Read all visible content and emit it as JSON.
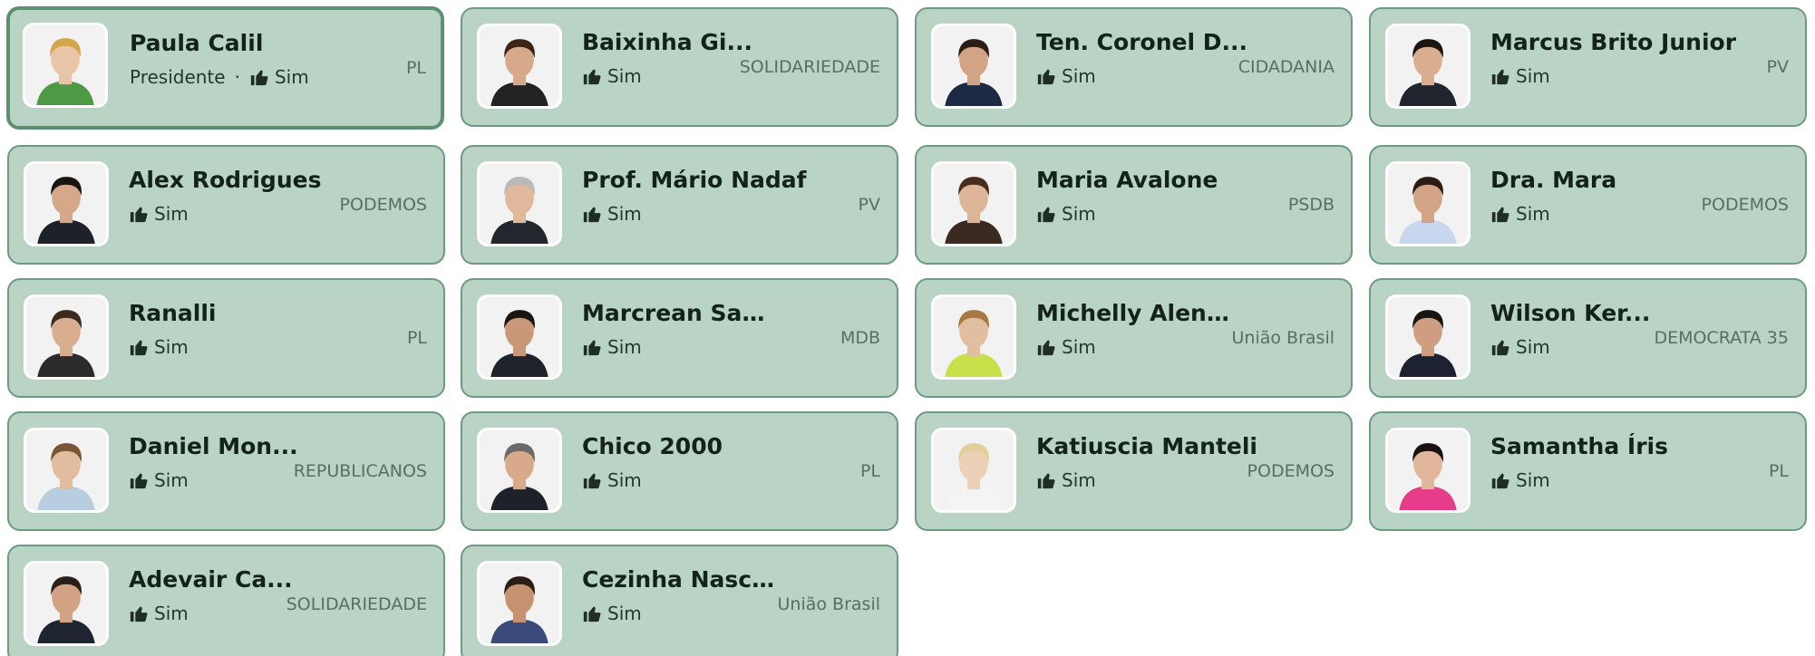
{
  "members": [
    {
      "name": "Paula Calil",
      "role": "Presidente",
      "vote": "Sim",
      "party": "PL",
      "selected": true,
      "skin": "#e8c5a8",
      "hair": "#d4a64a",
      "shirt": "#4e9a44"
    },
    {
      "name": "Baixinha Gi...",
      "role": "",
      "vote": "Sim",
      "party": "SOLIDARIEDADE",
      "selected": false,
      "skin": "#d6a98a",
      "hair": "#3a2518",
      "shirt": "#222222"
    },
    {
      "name": "Ten. Coronel D...",
      "role": "",
      "vote": "Sim",
      "party": "CIDADANIA",
      "selected": false,
      "skin": "#d3a386",
      "hair": "#2a1d16",
      "shirt": "#1c2a44"
    },
    {
      "name": "Marcus Brito Junior",
      "role": "",
      "vote": "Sim",
      "party": "PV",
      "selected": false,
      "skin": "#d9ae8e",
      "hair": "#1b1512",
      "shirt": "#20242c"
    },
    {
      "name": "Alex Rodrigues",
      "role": "",
      "vote": "Sim",
      "party": "PODEMOS",
      "selected": false,
      "skin": "#d6a88a",
      "hair": "#1a1410",
      "shirt": "#1d2128"
    },
    {
      "name": "Prof. Mário Nadaf",
      "role": "",
      "vote": "Sim",
      "party": "PV",
      "selected": false,
      "skin": "#e0b89c",
      "hair": "#b9b9b9",
      "shirt": "#22262d"
    },
    {
      "name": "Maria Avalone",
      "role": "",
      "vote": "Sim",
      "party": "PSDB",
      "selected": false,
      "skin": "#dcb497",
      "hair": "#4a2c1c",
      "shirt": "#3a2a22"
    },
    {
      "name": "Dra. Mara",
      "role": "",
      "vote": "Sim",
      "party": "PODEMOS",
      "selected": false,
      "skin": "#d4a486",
      "hair": "#2c1c14",
      "shirt": "#c8d6ee"
    },
    {
      "name": "Ranalli",
      "role": "",
      "vote": "Sim",
      "party": "PL",
      "selected": false,
      "skin": "#d9ad90",
      "hair": "#3b2a1e",
      "shirt": "#2b2b2b"
    },
    {
      "name": "Marcrean Santos",
      "role": "",
      "vote": "Sim",
      "party": "MDB",
      "selected": false,
      "skin": "#c99878",
      "hair": "#1c1410",
      "shirt": "#1f232a"
    },
    {
      "name": "Michelly Alencar",
      "role": "",
      "vote": "Sim",
      "party": "União Brasil",
      "selected": false,
      "skin": "#e2bea0",
      "hair": "#a77a45",
      "shirt": "#c8e04a"
    },
    {
      "name": "Wilson Ker...",
      "role": "",
      "vote": "Sim",
      "party": "DEMOCRATA 35",
      "selected": false,
      "skin": "#cf9e80",
      "hair": "#1a1410",
      "shirt": "#1c2230"
    },
    {
      "name": "Daniel Mon...",
      "role": "",
      "vote": "Sim",
      "party": "REPUBLICANOS",
      "selected": false,
      "skin": "#e2bc9e",
      "hair": "#7a5634",
      "shirt": "#b9cde0"
    },
    {
      "name": "Chico 2000",
      "role": "",
      "vote": "Sim",
      "party": "PL",
      "selected": false,
      "skin": "#d8a98a",
      "hair": "#6a6a6a",
      "shirt": "#1d2129"
    },
    {
      "name": "Katiuscia Manteli",
      "role": "",
      "vote": "Sim",
      "party": "PODEMOS",
      "selected": false,
      "skin": "#ecd0b8",
      "hair": "#e3cf9a",
      "shirt": "#f4f4f4"
    },
    {
      "name": "Samantha Íris",
      "role": "",
      "vote": "Sim",
      "party": "PL",
      "selected": false,
      "skin": "#e2b69a",
      "hair": "#1a1210",
      "shirt": "#e63c8a"
    },
    {
      "name": "Adevair Ca...",
      "role": "",
      "vote": "Sim",
      "party": "SOLIDARIEDADE",
      "selected": false,
      "skin": "#d2a284",
      "hair": "#2a2018",
      "shirt": "#1e2430"
    },
    {
      "name": "Cezinha Nasci...",
      "role": "",
      "vote": "Sim",
      "party": "União Brasil",
      "selected": false,
      "skin": "#c6926f",
      "hair": "#2a1d14",
      "shirt": "#3a4a7a"
    }
  ],
  "colors": {
    "card_bg": "#b9d4c5",
    "card_border": "#6e9a83",
    "selected_border": "#5f8f72",
    "name_text": "#14231a",
    "party_text": "#56705f"
  },
  "icons": {
    "vote": "thumbs-up-icon",
    "photo": "member-photo"
  }
}
